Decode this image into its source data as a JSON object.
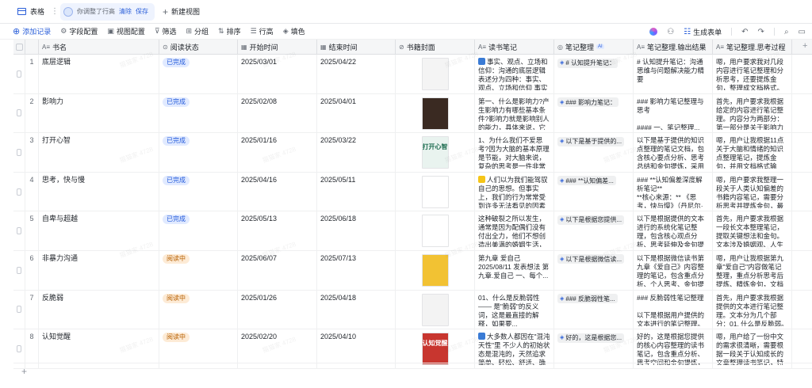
{
  "tabs": {
    "table_label": "表格",
    "edit_notice": "你调整了行高",
    "clear_label": "清除",
    "save_label": "保存",
    "new_view_label": "新建视图"
  },
  "toolbar": {
    "add_record": "添加记录",
    "field_config": "字段配置",
    "view_config": "视图配置",
    "filter": "筛选",
    "group": "分组",
    "sort": "排序",
    "row_height": "行高",
    "fill_color": "填色",
    "generate_form": "生成表单"
  },
  "columns": [
    {
      "label": "书名",
      "icon": "text-icon"
    },
    {
      "label": "阅读状态",
      "icon": "status-icon"
    },
    {
      "label": "开始时间",
      "icon": "date-icon"
    },
    {
      "label": "结束时间",
      "icon": "date-icon"
    },
    {
      "label": "书籍封面",
      "icon": "attachment-icon"
    },
    {
      "label": "读书笔记",
      "icon": "text-icon"
    },
    {
      "label": "笔记整理",
      "icon": "ai-icon",
      "ai_tag": "AI"
    },
    {
      "label": "笔记整理.输出结果",
      "icon": "text-icon"
    },
    {
      "label": "笔记整理.思考过程",
      "icon": "text-icon"
    }
  ],
  "rows": [
    {
      "num": "1",
      "title": "底层逻辑",
      "status": "已完成",
      "status_kind": "done",
      "start": "2025/03/01",
      "end": "2025/04/22",
      "cover_color": "#f4f4f4",
      "cover_text": "",
      "note": "事实、观点、立场和信仰：沟通的底层逻辑 表述分为四种：事实、观点、立场和信仰 事实是客观...",
      "note_emoji_color": "#3a7bd5",
      "ai_tag": "# 认知提升笔记：",
      "result": "# 认知提升笔记：沟通思维与问题解决能力精要\n\n## 一、沟通的底层逻辑...",
      "thinking": "嗯，用户要求我对几段内容进行笔记整理和分析思考，还要提炼金句，整理成文档格式。这些内容..."
    },
    {
      "num": "2",
      "title": "影响力",
      "status": "已完成",
      "status_kind": "done",
      "start": "2025/02/08",
      "end": "2025/04/01",
      "cover_color": "#3a2a22",
      "cover_text": "",
      "note": "第一、什么是影响力?产生影响力有哪些基本条件?影响力就是影响别人的能力，具体来说，它是用...",
      "note_emoji_color": "",
      "ai_tag": "### 影响力笔记：",
      "result": "### 影响力笔记整理与思考\n\n#### 一、笔记整理...",
      "thinking": "首先，用户要求我根据给定的内容进行笔记整理。内容分为两部分：第一部分是关于影响力的定义..."
    },
    {
      "num": "3",
      "title": "打开心智",
      "status": "已完成",
      "status_kind": "done",
      "start": "2025/01/16",
      "end": "2025/03/22",
      "cover_color": "#e9f3ef",
      "cover_text": "打开心智",
      "note": "1、为什么我们不爱思考?因为大脑的基本原理是节能，对大脑来说，复杂的思考是一件非常耗能的...",
      "note_emoji_color": "",
      "ai_tag": "以下是基于提供的...",
      "result": "以下是基于提供的知识点整理的笔记文档，包含核心要点分析、思考总结和金句提炼，采用结构化...",
      "thinking": "嗯，用户让我根据11点关于大脑和情绪的知识点整理笔记，提炼金句，并用文档格式输出。首先，..."
    },
    {
      "num": "4",
      "title": "思考，快与慢",
      "status": "已完成",
      "status_kind": "done",
      "start": "2025/04/16",
      "end": "2025/05/11",
      "cover_color": "#ffffff",
      "cover_text": "",
      "note": "人们以为我们能驾驭自己的思想。但事实上，我们的行为常常受到许多无法看见的因素所影响。...",
      "note_emoji_color": "#f5c518",
      "ai_tag": "### **认知偏差...",
      "result": "### **认知偏差深度解析笔记**\n**核心来源：** 《思考，快与慢》（丹尼尔·卡尼...",
      "thinking": "嗯，用户要求我整理一段关于人类认知偏差的书籍内容笔记，需要分析思考并提炼金句，最后用..."
    },
    {
      "num": "5",
      "title": "自卑与超越",
      "status": "已完成",
      "status_kind": "done",
      "start": "2025/05/13",
      "end": "2025/06/18",
      "cover_color": "#ffffff",
      "cover_text": "",
      "note": "这种破裂之所以发生，通常是因为配偶们没有付出全力，他们不想创造出美满的婚姻生活，而只等...",
      "note_emoji_color": "",
      "ai_tag": "以下是根据您提供...",
      "result": "以下是根据提供的文本进行的系统化笔记整理，包含核心观点分析、思考延伸及金句提炼，采用...",
      "thinking": "首先，用户要求我根据一段长文本整理笔记，提取关键想法和金句。文本涉及婚姻观、人生观等深层..."
    },
    {
      "num": "6",
      "title": "非暴力沟通",
      "status": "阅读中",
      "status_kind": "reading",
      "start": "2025/06/07",
      "end": "2025/07/13",
      "cover_color": "#f2c233",
      "cover_text": "",
      "note": "第九章 爱自己\n\n2025/08/11 发表想法\n第九章.爱自己 一、每个...",
      "note_emoji_color": "",
      "ai_tag": "以下是根据微信读...",
      "result": "以下是根据微信读书第九章《爱自己》内容整理的笔记，包含重点分析、个人思考、金句提炼及文...",
      "thinking": "嗯，用户让我根据第九章\"爱自己\"内容做笔记整理，重点分析思考后提炼、精炼金句，文档格式输出。..."
    },
    {
      "num": "7",
      "title": "反脆弱",
      "status": "阅读中",
      "status_kind": "reading",
      "start": "2025/01/26",
      "end": "2025/04/18",
      "cover_color": "#f3f3f3",
      "cover_text": "",
      "note": "01、什么是反脆弱性 —— 是\"脆弱\"的反义词，这是最直接的解释，如果要...",
      "note_emoji_color": "",
      "ai_tag": "### 反脆弱性笔...",
      "result": "### 反脆弱性笔记整理\n\n以下是根据用户提供的文本进行的笔记整理。内...",
      "thinking": "首先，用户要求我根据提供的文本进行笔记整理。文本分为几个部分：01. 什么是反脆弱。02. 反脆..."
    },
    {
      "num": "8",
      "title": "认知觉醒",
      "status": "阅读中",
      "status_kind": "reading",
      "start": "2025/02/20",
      "end": "2025/04/10",
      "cover_color": "#c8362f",
      "cover_text": "认知觉醒",
      "note": "大多数人都因在\"混沌天性\"里 不少人的初始状态是混沌的，天然追求简单、轻松、舒适、确定。...",
      "note_emoji_color": "#3a7bd5",
      "ai_tag": "好的，这是根据您...",
      "result": "好的，这是根据您提供的核心内容整理的读书笔记，包含重点分析、思考空间和金句提炼，以结构...",
      "thinking": "嗯，用户给了一份中文的需求很清晰，需要根据一段关于认知成长的文章整理读书笔记，特别强调要包含..."
    }
  ],
  "watermark": "猫猫家 4728"
}
